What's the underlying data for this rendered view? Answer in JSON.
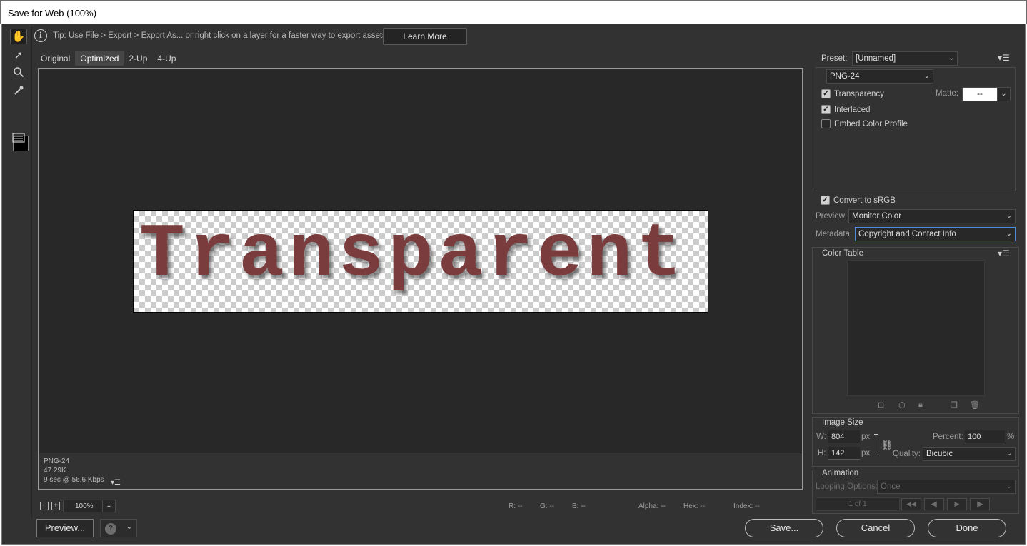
{
  "window": {
    "title": "Save for Web (100%)"
  },
  "tip": {
    "text": "Tip: Use File > Export > Export As...  or right click on a layer for a faster way to export assets",
    "learn_more": "Learn More"
  },
  "tabs": [
    {
      "label": "Original",
      "active": false
    },
    {
      "label": "Optimized",
      "active": true
    },
    {
      "label": "2-Up",
      "active": false
    },
    {
      "label": "4-Up",
      "active": false
    }
  ],
  "preview": {
    "image_text": "Transparent",
    "format": "PNG-24",
    "size": "47.29K",
    "download_time": "9 sec @ 56.6 Kbps"
  },
  "zoom": {
    "value": "100%"
  },
  "readouts": {
    "r": "R: --",
    "g": "G: --",
    "b": "B: --",
    "alpha": "Alpha: --",
    "hex": "Hex: --",
    "index": "Index: --"
  },
  "buttons": {
    "preview": "Preview...",
    "save": "Save...",
    "cancel": "Cancel",
    "done": "Done"
  },
  "settings": {
    "preset_label": "Preset:",
    "preset_value": "[Unnamed]",
    "format_value": "PNG-24",
    "transparency": {
      "label": "Transparency",
      "checked": true
    },
    "matte_label": "Matte:",
    "matte_value": "--",
    "interlaced": {
      "label": "Interlaced",
      "checked": true
    },
    "embed_color_profile": {
      "label": "Embed Color Profile",
      "checked": false
    },
    "convert_srgb": {
      "label": "Convert to sRGB",
      "checked": true
    },
    "preview_label": "Preview:",
    "preview_value": "Monitor Color",
    "metadata_label": "Metadata:",
    "metadata_value": "Copyright and Contact Info"
  },
  "color_table": {
    "title": "Color Table"
  },
  "image_size": {
    "title": "Image Size",
    "w_label": "W:",
    "w_value": "804",
    "h_label": "H:",
    "h_value": "142",
    "unit": "px",
    "percent_label": "Percent:",
    "percent_value": "100",
    "percent_unit": "%",
    "quality_label": "Quality:",
    "quality_value": "Bicubic"
  },
  "animation": {
    "title": "Animation",
    "looping_label": "Looping Options:",
    "looping_value": "Once",
    "frame_counter": "1 of 1"
  }
}
